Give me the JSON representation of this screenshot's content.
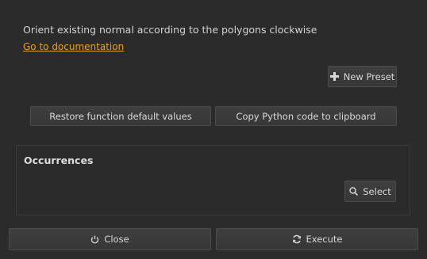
{
  "description": "Orient existing normal according to the polygons clockwise",
  "doc_link": "Go to documentation",
  "toolbar": {
    "new_preset": "New Preset",
    "restore_defaults": "Restore function default values",
    "copy_python": "Copy Python code to clipboard"
  },
  "occurrences": {
    "title": "Occurrences",
    "select": "Select"
  },
  "footer": {
    "close": "Close",
    "execute": "Execute"
  },
  "colors": {
    "background": "#2b2b2b",
    "link": "#e8a01f",
    "button": "#3c3c3c"
  },
  "icons": {
    "new_preset": "plus-icon",
    "select": "search-icon",
    "close": "power-icon",
    "execute": "refresh-icon"
  }
}
